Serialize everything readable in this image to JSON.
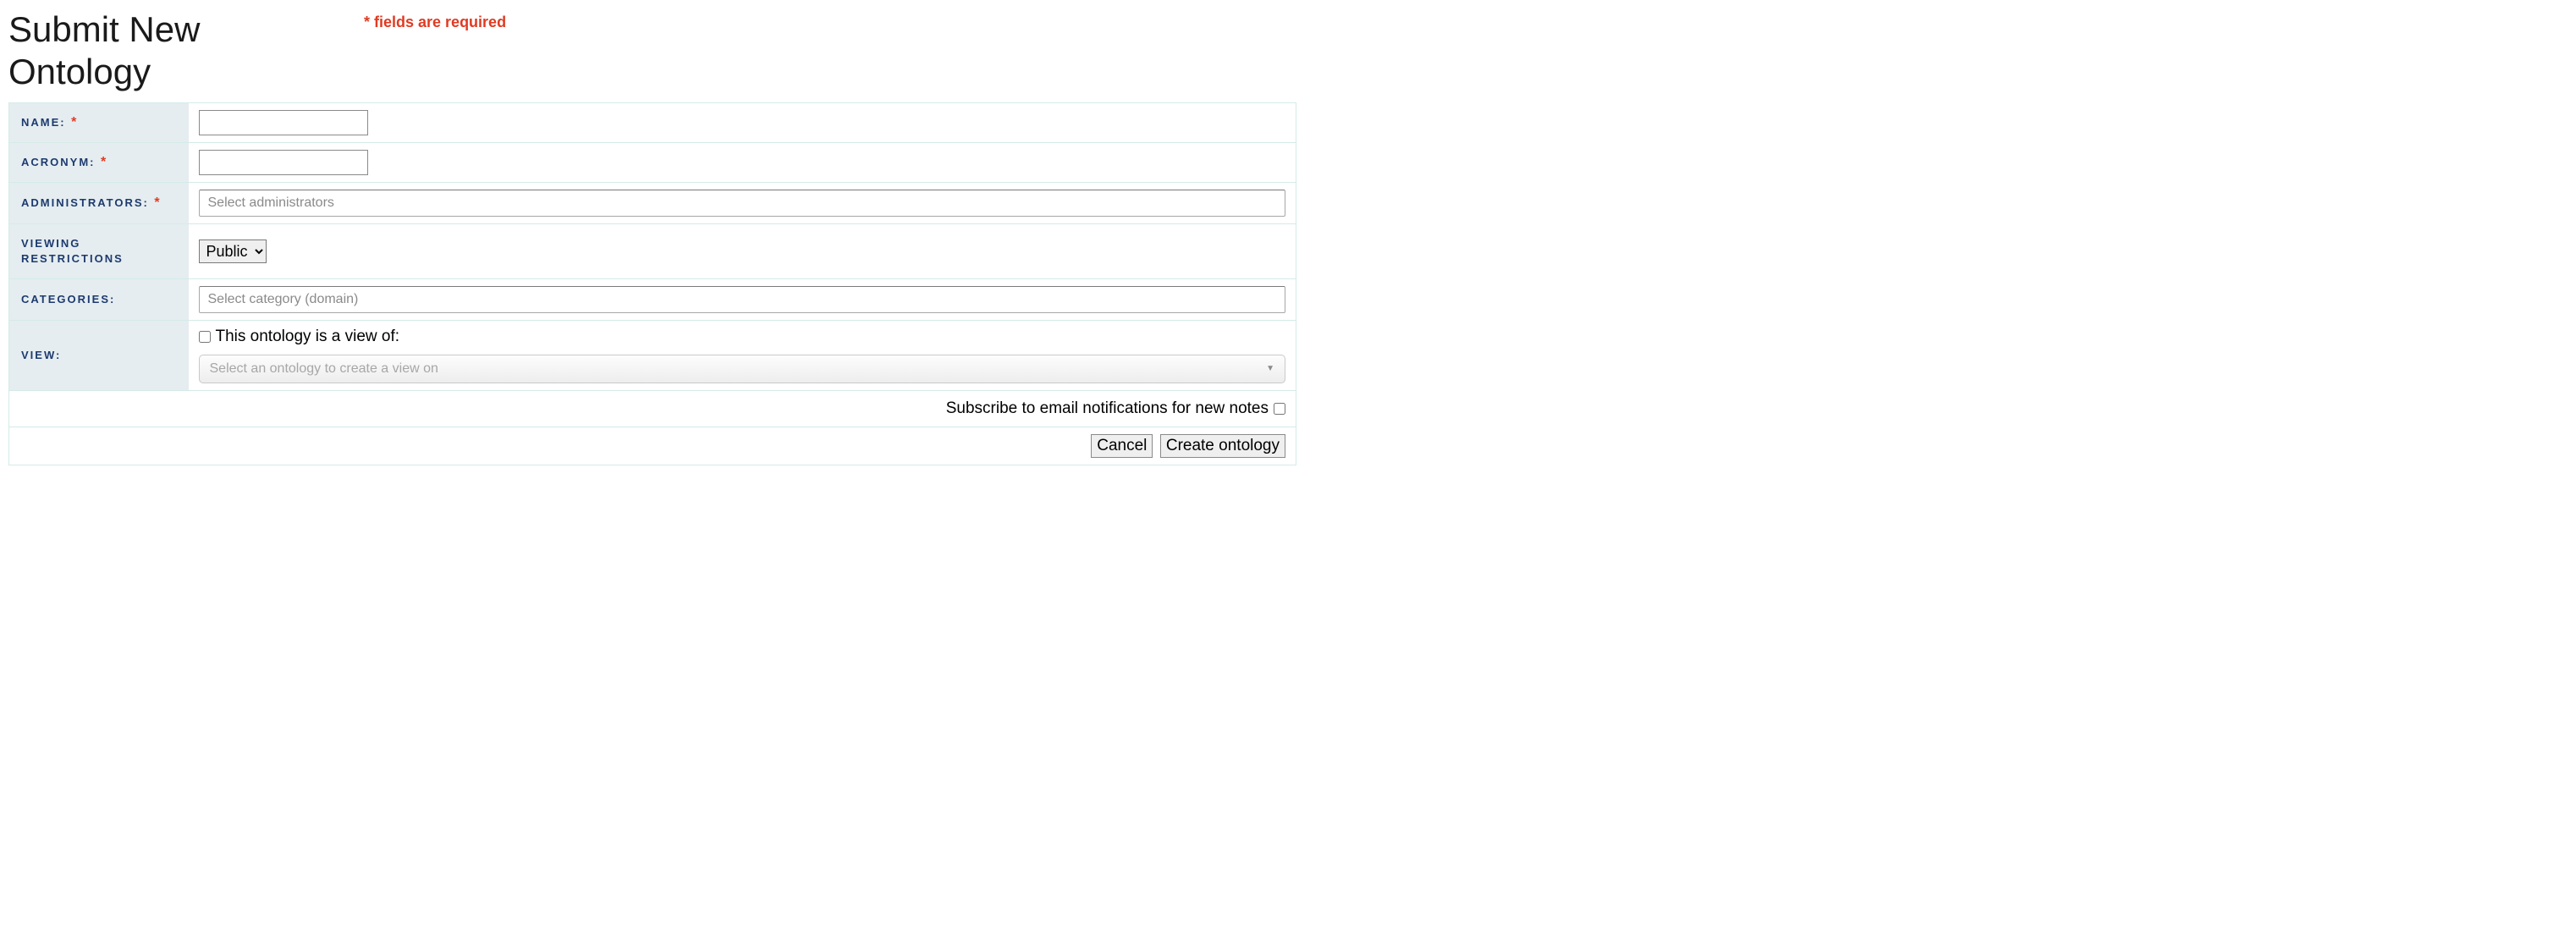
{
  "header": {
    "title": "Submit New Ontology",
    "required_note": "* fields are required"
  },
  "form": {
    "name": {
      "label": "NAME:",
      "required": true,
      "value": ""
    },
    "acronym": {
      "label": "ACRONYM:",
      "required": true,
      "value": ""
    },
    "administrators": {
      "label": "ADMINISTRATORS:",
      "required": true,
      "placeholder": "Select administrators"
    },
    "viewing_restrictions": {
      "label": "VIEWING RESTRICTIONS",
      "required": false,
      "selected": "Public"
    },
    "categories": {
      "label": "CATEGORIES:",
      "required": false,
      "placeholder": "Select category (domain)"
    },
    "view": {
      "label": "VIEW:",
      "required": false,
      "checkbox_label": "This ontology is a view of:",
      "select_placeholder": "Select an ontology to create a view on",
      "checked": false
    },
    "subscribe": {
      "label": "Subscribe to email notifications for new notes",
      "checked": false
    },
    "buttons": {
      "cancel": "Cancel",
      "submit": "Create ontology"
    }
  },
  "required_asterisk": "*"
}
